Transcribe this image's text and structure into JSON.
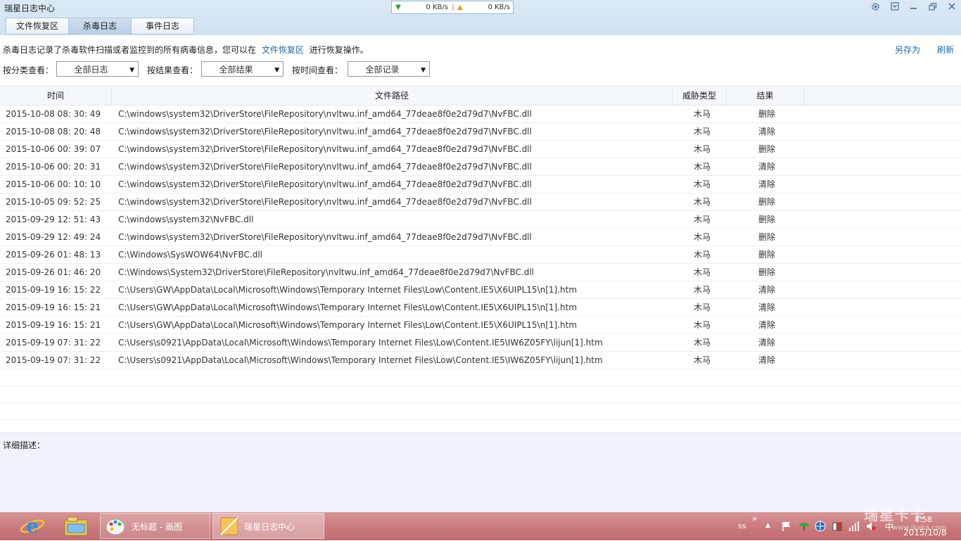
{
  "app": {
    "title": "瑞星日志中心",
    "download_speed": "0 KB/s",
    "upload_speed": "0 KB/s"
  },
  "tabs": [
    {
      "label": "文件恢复区",
      "active": false
    },
    {
      "label": "杀毒日志",
      "active": true
    },
    {
      "label": "事件日志",
      "active": false
    }
  ],
  "info": {
    "prefix": "杀毒日志记录了杀毒软件扫描或者监控到的所有病毒信息，您可以在",
    "link": "文件恢复区",
    "suffix": "进行恢复操作。",
    "save_as": "另存为",
    "refresh": "刷新"
  },
  "filters": {
    "category_label": "按分类查看：",
    "category_value": "全部日志",
    "result_label": "按结果查看：",
    "result_value": "全部结果",
    "time_label": "按时间查看：",
    "time_value": "全部记录"
  },
  "table": {
    "headers": {
      "time": "时间",
      "path": "文件路径",
      "threat": "威胁类型",
      "result": "结果"
    },
    "rows": [
      {
        "time": "2015-10-08 08: 30: 49",
        "path": "C:\\windows\\system32\\DriverStore\\FileRepository\\nvltwu.inf_amd64_77deae8f0e2d79d7\\NvFBC.dll",
        "threat": "木马",
        "result": "删除"
      },
      {
        "time": "2015-10-08 08: 20: 48",
        "path": "C:\\windows\\system32\\DriverStore\\FileRepository\\nvltwu.inf_amd64_77deae8f0e2d79d7\\NvFBC.dll",
        "threat": "木马",
        "result": "清除"
      },
      {
        "time": "2015-10-06 00: 39: 07",
        "path": "C:\\windows\\system32\\DriverStore\\FileRepository\\nvltwu.inf_amd64_77deae8f0e2d79d7\\NvFBC.dll",
        "threat": "木马",
        "result": "删除"
      },
      {
        "time": "2015-10-06 00: 20: 31",
        "path": "C:\\windows\\system32\\DriverStore\\FileRepository\\nvltwu.inf_amd64_77deae8f0e2d79d7\\NvFBC.dll",
        "threat": "木马",
        "result": "清除"
      },
      {
        "time": "2015-10-06 00: 10: 10",
        "path": "C:\\windows\\system32\\DriverStore\\FileRepository\\nvltwu.inf_amd64_77deae8f0e2d79d7\\NvFBC.dll",
        "threat": "木马",
        "result": "清除"
      },
      {
        "time": "2015-10-05 09: 52: 25",
        "path": "C:\\windows\\system32\\DriverStore\\FileRepository\\nvltwu.inf_amd64_77deae8f0e2d79d7\\NvFBC.dll",
        "threat": "木马",
        "result": "删除"
      },
      {
        "time": "2015-09-29 12: 51: 43",
        "path": "C:\\windows\\system32\\NvFBC.dll",
        "threat": "木马",
        "result": "删除"
      },
      {
        "time": "2015-09-29 12: 49: 24",
        "path": "C:\\windows\\system32\\DriverStore\\FileRepository\\nvltwu.inf_amd64_77deae8f0e2d79d7\\NvFBC.dll",
        "threat": "木马",
        "result": "删除"
      },
      {
        "time": "2015-09-26 01: 48: 13",
        "path": "C:\\Windows\\SysWOW64\\NvFBC.dll",
        "threat": "木马",
        "result": "删除"
      },
      {
        "time": "2015-09-26 01: 46: 20",
        "path": "C:\\Windows\\System32\\DriverStore\\FileRepository\\nvltwu.inf_amd64_77deae8f0e2d79d7\\NvFBC.dll",
        "threat": "木马",
        "result": "删除"
      },
      {
        "time": "2015-09-19 16: 15: 22",
        "path": "C:\\Users\\GW\\AppData\\Local\\Microsoft\\Windows\\Temporary Internet Files\\Low\\Content.IE5\\X6UIPL15\\n[1].htm",
        "threat": "木马",
        "result": "清除"
      },
      {
        "time": "2015-09-19 16: 15: 21",
        "path": "C:\\Users\\GW\\AppData\\Local\\Microsoft\\Windows\\Temporary Internet Files\\Low\\Content.IE5\\X6UIPL15\\n[1].htm",
        "threat": "木马",
        "result": "清除"
      },
      {
        "time": "2015-09-19 16: 15: 21",
        "path": "C:\\Users\\GW\\AppData\\Local\\Microsoft\\Windows\\Temporary Internet Files\\Low\\Content.IE5\\X6UIPL15\\n[1].htm",
        "threat": "木马",
        "result": "清除"
      },
      {
        "time": "2015-09-19 07: 31: 22",
        "path": "C:\\Users\\s0921\\AppData\\Local\\Microsoft\\Windows\\Temporary Internet Files\\Low\\Content.IE5\\IW6Z05FY\\lijun[1].htm",
        "threat": "木马",
        "result": "清除"
      },
      {
        "time": "2015-09-19 07: 31: 22",
        "path": "C:\\Users\\s0921\\AppData\\Local\\Microsoft\\Windows\\Temporary Internet Files\\Low\\Content.IE5\\IW6Z05FY\\lijun[1].htm",
        "threat": "木马",
        "result": "清除"
      }
    ]
  },
  "detail": {
    "label": "详细描述："
  },
  "taskbar": {
    "tasks": [
      {
        "label": "无标题 - 画图"
      },
      {
        "label": "瑞星日志中心"
      }
    ],
    "tray_text": "ss",
    "ime": "中",
    "time": "8:58",
    "date": "2015/10/8",
    "chevron": "»",
    "watermark": "www.ikaka.com"
  },
  "icons": {
    "settings": "gear-icon",
    "skin": "skin-icon",
    "minimize": "minimize-icon",
    "maximize": "maximize-icon",
    "close": "close-icon"
  },
  "colors": {
    "link": "#1d6aa8",
    "title_bar": "#d3e4f4",
    "taskbar": "#c9777b"
  }
}
